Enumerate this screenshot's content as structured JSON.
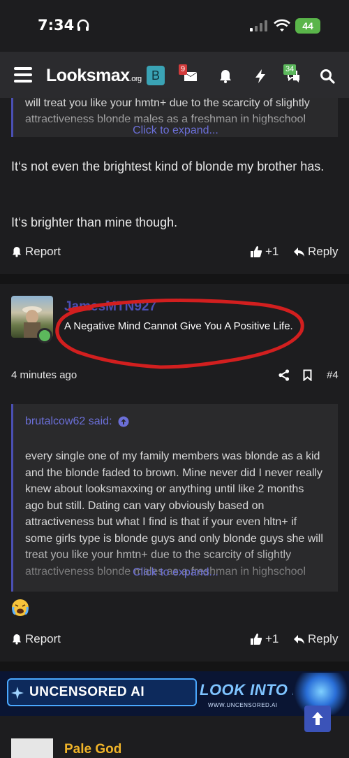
{
  "status_bar": {
    "time": "7:34",
    "battery": "44"
  },
  "nav": {
    "logo_main": "Looksmax",
    "logo_suffix": ".org",
    "b_label": "B",
    "inbox_badge": "9",
    "alerts_badge": "34"
  },
  "top_quote": {
    "lines": "will treat you like your hmtn+ due to the scarcity of slightly attractiveness blonde males as a freshman in highschool",
    "expand": "Click to expand..."
  },
  "prev_post": {
    "para1": "It‘s not even the brightest kind of blonde my brother has.",
    "para2": "It‘s brighter than mine though."
  },
  "actions": {
    "report": "Report",
    "likes": "+1",
    "reply": "Reply"
  },
  "post4": {
    "username": "JamesMTN927",
    "user_title": "A Negative Mind Cannot Give You A Positive Life.",
    "time": "4 minutes ago",
    "number": "#4",
    "quote_author": "brutalcow62 said:",
    "quote_body": "every single one of my family members was blonde as a kid and the blonde faded to brown. Mine never did I never really knew about looksmaxxing or anything until like 2 months ago but still. Dating can vary obviously based on attractiveness but what I find is that if your even hltn+ if some girls type is blonde guys and only blonde guys she will treat you like your hmtn+ due to the scarcity of slightly attractiveness blonde males as a freshman in highschool",
    "expand": "Click to expand...",
    "emoji": "😭"
  },
  "ad": {
    "left": "UNCENSORED AI",
    "right": "LOOK INTO IT",
    "url": "WWW.UNCENSORED.AI"
  },
  "next_post": {
    "username": "Pale God"
  },
  "colors": {
    "accent": "#4a4fb3",
    "link": "#6b6fd8",
    "annotation": "#d21f1f"
  }
}
